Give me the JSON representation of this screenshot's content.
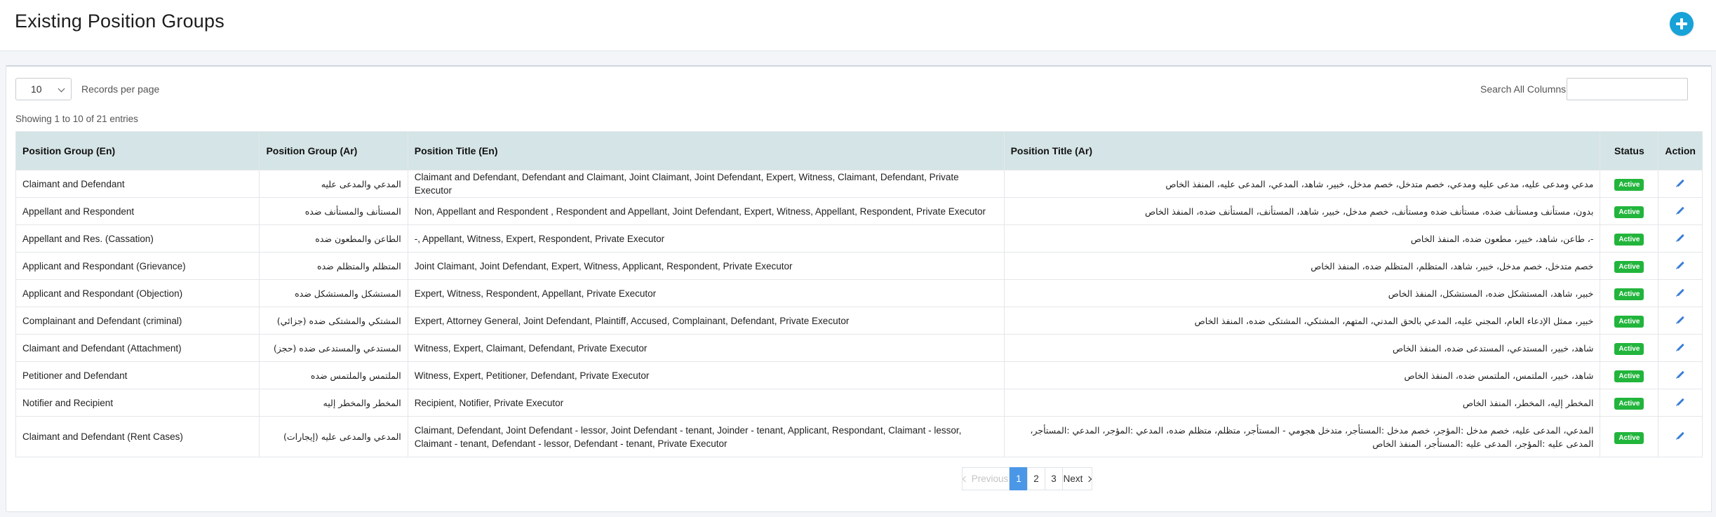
{
  "header": {
    "title": "Existing Position Groups"
  },
  "controls": {
    "page_length": "10",
    "records_label": "Records per page",
    "search_label": "Search All Columns:",
    "search_value": ""
  },
  "info": "Showing 1 to 10 of 21 entries",
  "table": {
    "columns": [
      "Position Group (En)",
      "Position Group (Ar)",
      "Position Title (En)",
      "Position Title (Ar)",
      "Status",
      "Action"
    ],
    "rows": [
      {
        "en": "Claimant and Defendant",
        "ar": "المدعي والمدعى عليه",
        "title_en": "Claimant and Defendant, Defendant and Claimant, Joint Claimant, Joint Defendant, Expert, Witness, Claimant, Defendant, Private Executor",
        "title_ar": "مدعي ومدعى عليه، مدعى عليه ومدعي، خصم متدخل، خصم مدخل، خبير، شاهد، المدعي، المدعى عليه، المنفذ الخاص",
        "status": "Active"
      },
      {
        "en": "Appellant and Respondent",
        "ar": "المستأنف والمستأنف ضده",
        "title_en": "Non, Appellant and Respondent , Respondent and Appellant, Joint Defendant, Expert, Witness, Appellant, Respondent, Private Executor",
        "title_ar": "بدون، مستأنف ومستأنف ضده، مستأنف ضده ومستأنف، خصم مدخل، خبير، شاهد، المستأنف، المستأنف ضده، المنفذ الخاص",
        "status": "Active"
      },
      {
        "en": "Appellant and Res. (Cassation)",
        "ar": "الطاعن والمطعون ضده",
        "title_en": "-, Appellant, Witness, Expert, Respondent, Private Executor",
        "title_ar": "-، طاعن، شاهد، خبير، مطعون ضده، المنفذ الخاص",
        "status": "Active"
      },
      {
        "en": "Applicant and Respondant (Grievance)",
        "ar": "المتظلم والمتظلم ضده",
        "title_en": "Joint Claimant, Joint Defendant, Expert, Witness, Applicant, Respondent, Private Executor",
        "title_ar": "خصم متدخل، خصم مدخل، خبير، شاهد، المتظلم، المتظلم ضده، المنفذ الخاص",
        "status": "Active"
      },
      {
        "en": "Applicant and Respondant (Objection)",
        "ar": "المستشكل والمستشكل ضده",
        "title_en": "Expert, Witness, Respondent, Appellant, Private Executor",
        "title_ar": "خبير، شاهد، المستشكل ضده، المستشكل، المنفذ الخاص",
        "status": "Active"
      },
      {
        "en": "Complainant and Defendant (criminal)",
        "ar": "المشتكي والمشتكى ضده (جزائي)",
        "title_en": "Expert, Attorney General, Joint Defendant, Plaintiff, Accused, Complainant, Defendant, Private Executor",
        "title_ar": "خبير، ممثل الإدعاء العام، المجني عليه، المدعي بالحق المدني، المتهم، المشتكي، المشتكى ضده، المنفذ الخاص",
        "status": "Active"
      },
      {
        "en": "Claimant and Defendant (Attachment)",
        "ar": "المستدعي والمستدعى ضده (حجز)",
        "title_en": "Witness, Expert, Claimant, Defendant, Private Executor",
        "title_ar": "شاهد، خبير، المستدعي، المستدعى ضده، المنفذ الخاص",
        "status": "Active"
      },
      {
        "en": "Petitioner and Defendant",
        "ar": "الملتمس والملتمس ضده",
        "title_en": "Witness, Expert, Petitioner, Defendant, Private Executor",
        "title_ar": "شاهد، خبير، الملتمس، الملتمس ضده، المنفذ الخاص",
        "status": "Active"
      },
      {
        "en": "Notifier and Recipient",
        "ar": "المخطر والمخطر إليه",
        "title_en": "Recipient, Notifier, Private Executor",
        "title_ar": "المخطر إليه، المخطر، المنفذ الخاص",
        "status": "Active"
      },
      {
        "en": "Claimant and Defendant (Rent Cases)",
        "ar": "المدعي والمدعى عليه (إيجارات)",
        "title_en": "Claimant, Defendant, Joint Defendant - lessor, Joint Defendant - tenant, Joinder - tenant, Applicant, Respondant, Claimant - lessor, Claimant - tenant, Defendant - lessor, Defendant - tenant, Private Executor",
        "title_ar": "المدعي، المدعى عليه، خصم مدخل :المؤجر، خصم مدخل :المستأجر، متدخل هجومي - المستأجر، متظلم، متظلم ضده، المدعي :المؤجر، المدعي :المستأجر، المدعى عليه :المؤجر، المدعى عليه :المستأجر، المنفذ الخاص",
        "status": "Active"
      }
    ]
  },
  "pagination": {
    "previous": "Previous",
    "pages": [
      "1",
      "2",
      "3"
    ],
    "next": "Next",
    "current": "1"
  },
  "colors": {
    "header_bg": "#d5e4e6",
    "badge": "#22b53c",
    "accent": "#4a97e8",
    "add_button": "#17a2d8"
  },
  "icons": {
    "add": "plus-circle-icon",
    "edit": "pencil-icon"
  }
}
